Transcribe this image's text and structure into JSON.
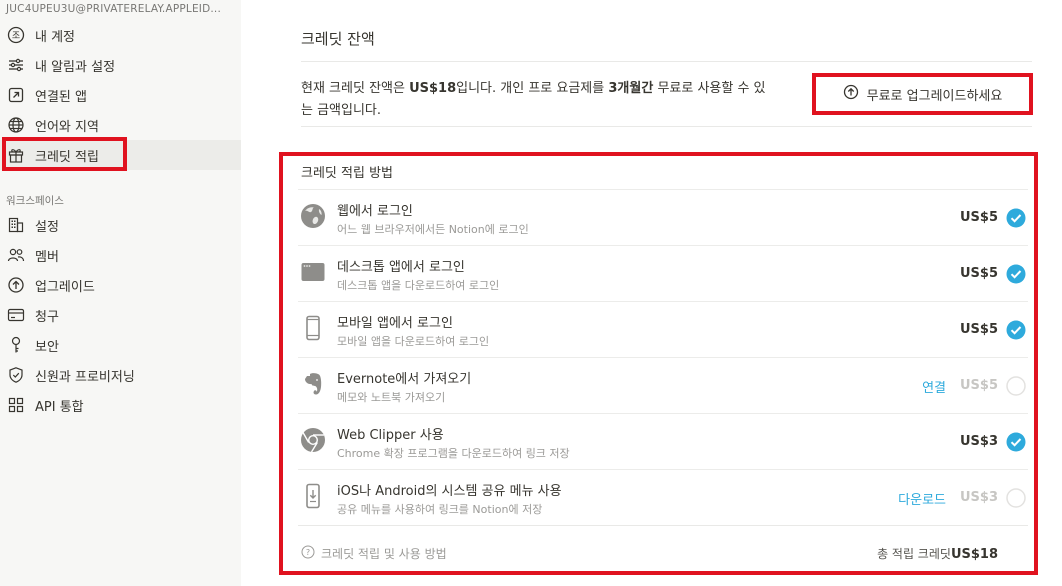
{
  "sidebar": {
    "account_email": "JUC4UPEU3U@PRIVATERELAY.APPLEID...",
    "account_items": [
      {
        "label": "내 계정",
        "icon": "account-icon"
      },
      {
        "label": "내 알림과 설정",
        "icon": "sliders-icon"
      },
      {
        "label": "연결된 앱",
        "icon": "external-link-icon"
      },
      {
        "label": "언어와 지역",
        "icon": "globe-icon"
      },
      {
        "label": "크레딧 적립",
        "icon": "gift-icon",
        "active": true
      }
    ],
    "workspace_label": "워크스페이스",
    "workspace_items": [
      {
        "label": "설정",
        "icon": "building-icon"
      },
      {
        "label": "멤버",
        "icon": "people-icon"
      },
      {
        "label": "업그레이드",
        "icon": "upgrade-icon"
      },
      {
        "label": "청구",
        "icon": "card-icon"
      },
      {
        "label": "보안",
        "icon": "key-icon"
      },
      {
        "label": "신원과 프로비저닝",
        "icon": "shield-icon"
      },
      {
        "label": "API 통합",
        "icon": "grid-icon"
      }
    ]
  },
  "main": {
    "title": "크레딧 잔액",
    "balance": {
      "prefix": "현재 크레딧 잔액은 ",
      "amount": "US$18",
      "mid": "입니다. 개인 프로 요금제를 ",
      "duration": "3개월간",
      "suffix": " 무료로 사용할 수 있",
      "line2": "는 금액입니다."
    },
    "upgrade_button": "무료로 업그레이드하세요",
    "methods_title": "크레딧 적립 방법",
    "methods": [
      {
        "title": "웹에서 로그인",
        "desc": "어느 웹 브라우저에서든 Notion에 로그인",
        "action": "",
        "amount": "US$5",
        "done": true,
        "icon": "web-globe-icon"
      },
      {
        "title": "데스크톱 앱에서 로그인",
        "desc": "데스크톱 앱을 다운로드하여 로그인",
        "action": "",
        "amount": "US$5",
        "done": true,
        "icon": "desktop-icon"
      },
      {
        "title": "모바일 앱에서 로그인",
        "desc": "모바일 앱을 다운로드하여 로그인",
        "action": "",
        "amount": "US$5",
        "done": true,
        "icon": "mobile-icon"
      },
      {
        "title": "Evernote에서 가져오기",
        "desc": "메모와 노트북 가져오기",
        "action": "연결",
        "amount": "US$5",
        "done": false,
        "icon": "evernote-icon"
      },
      {
        "title": "Web Clipper 사용",
        "desc": "Chrome 확장 프로그램을 다운로드하여 링크 저장",
        "action": "",
        "amount": "US$3",
        "done": true,
        "icon": "chrome-icon"
      },
      {
        "title": "iOS나 Android의 시스템 공유 메뉴 사용",
        "desc": "공유 메뉴를 사용하여 링크를 Notion에 저장",
        "action": "다운로드",
        "amount": "US$3",
        "done": false,
        "icon": "share-phone-icon"
      }
    ],
    "footer": {
      "help_link": "크레딧 적립 및 사용 방법",
      "total_label": "총 적립 크레딧",
      "total_amount": "US$18"
    }
  },
  "colors": {
    "accent_blue": "#2eaadc",
    "highlight_red": "#e0121f",
    "sidebar_bg": "#f7f7f5"
  }
}
